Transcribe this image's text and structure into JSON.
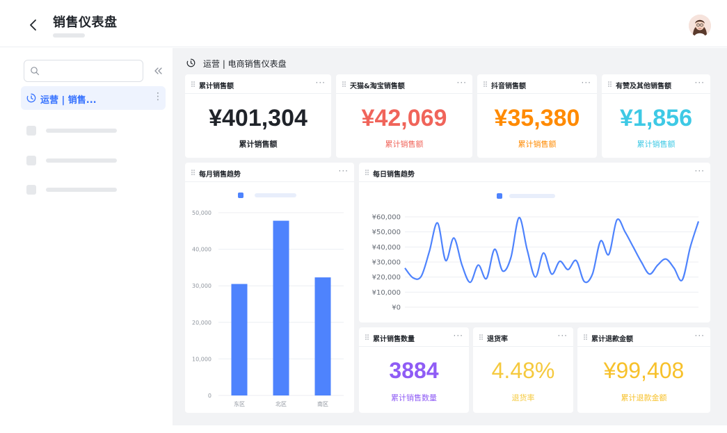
{
  "header": {
    "title": "销售仪表盘"
  },
  "sidebar": {
    "search": {
      "placeholder": "",
      "value": ""
    },
    "active_item": {
      "label": "运营 | 销售..."
    }
  },
  "main": {
    "breadcrumb": "运营 | 电商销售仪表盘"
  },
  "colors": {
    "accent": "#3370ff",
    "bar": "#4e83fd",
    "red": "#f0645a",
    "orange": "#ff8a00",
    "cyan": "#3ec9e5",
    "purple": "#8f5cf5",
    "yellow": "#f5c93d",
    "gold": "#f7c12b"
  },
  "kpis": {
    "total_sales": {
      "title": "累计销售额",
      "value": "¥401,304",
      "label": "累计销售额"
    },
    "tmall": {
      "title": "天猫&淘宝销售额",
      "value": "¥42,069",
      "label": "累计销售额"
    },
    "douyin": {
      "title": "抖音销售额",
      "value": "¥35,380",
      "label": "累计销售额"
    },
    "youzan": {
      "title": "有赞及其他销售额",
      "value": "¥1,856",
      "label": "累计销售额"
    },
    "quantity": {
      "title": "累计销售数量",
      "value": "3884",
      "label": "累计销售数量"
    },
    "refund_rate": {
      "title": "退货率",
      "value": "4.48%",
      "label": "退货率"
    },
    "refund_amount": {
      "title": "累计退款金额",
      "value": "¥99,408",
      "label": "累计退款金额"
    }
  },
  "chart_data": [
    {
      "type": "bar",
      "title": "每月销售趋势",
      "categories": [
        "东区",
        "北区",
        "南区"
      ],
      "values": [
        30500,
        47800,
        32300
      ],
      "ylim": [
        0,
        50000
      ],
      "yticks": [
        "0",
        "10,000",
        "20,000",
        "30,000",
        "40,000",
        "50,000"
      ],
      "ytick_values": [
        0,
        10000,
        20000,
        30000,
        40000,
        50000
      ],
      "grid": true
    },
    {
      "type": "line",
      "title": "每日销售趋势",
      "x": [
        0,
        1,
        2,
        3,
        4,
        5,
        6,
        7,
        8,
        9,
        10,
        11,
        12,
        13,
        14,
        15,
        16,
        17,
        18,
        19,
        20,
        21,
        22,
        23,
        24,
        25,
        26,
        27,
        28,
        29,
        30,
        31,
        32,
        33,
        34,
        35,
        36
      ],
      "values": [
        26000,
        19500,
        20500,
        37000,
        56000,
        31000,
        46000,
        28000,
        16500,
        28000,
        19000,
        38500,
        24000,
        33000,
        59500,
        38000,
        20000,
        36000,
        22000,
        30500,
        25000,
        31000,
        17000,
        22000,
        44000,
        35000,
        58000,
        50000,
        40000,
        30000,
        22000,
        28000,
        32000,
        26000,
        18000,
        40000,
        57000
      ],
      "ylim": [
        0,
        60000
      ],
      "yticks": [
        "¥0",
        "¥10,000",
        "¥20,000",
        "¥30,000",
        "¥40,000",
        "¥50,000",
        "¥60,000"
      ],
      "ytick_values": [
        0,
        10000,
        20000,
        30000,
        40000,
        50000,
        60000
      ],
      "grid": true
    }
  ]
}
